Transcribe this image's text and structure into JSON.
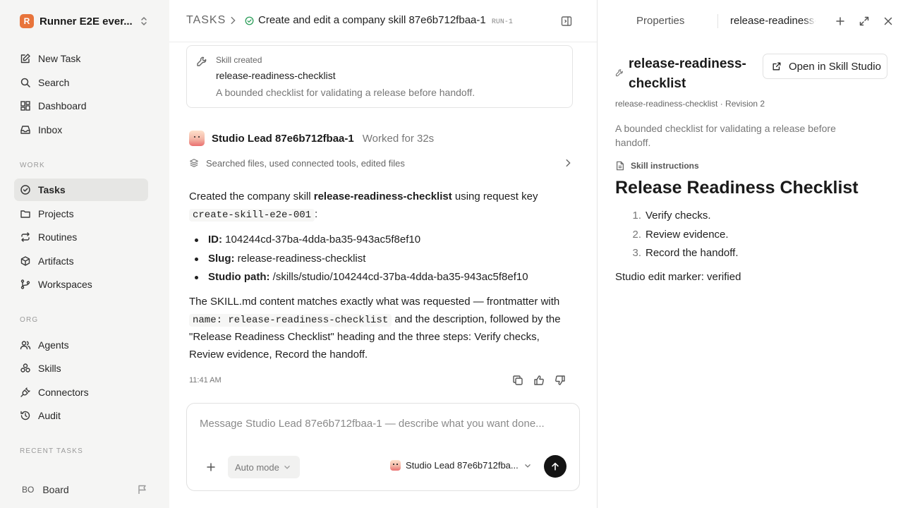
{
  "workspace": {
    "logo": "R",
    "name": "Runner E2E ever..."
  },
  "nav_main": [
    {
      "label": "New Task",
      "icon": "edit-icon"
    },
    {
      "label": "Search",
      "icon": "search-icon"
    },
    {
      "label": "Dashboard",
      "icon": "dashboard-icon"
    },
    {
      "label": "Inbox",
      "icon": "inbox-icon"
    }
  ],
  "section_work": "WORK",
  "nav_work": [
    {
      "label": "Tasks",
      "icon": "check-circle-icon",
      "active": true
    },
    {
      "label": "Projects",
      "icon": "folder-icon"
    },
    {
      "label": "Routines",
      "icon": "repeat-icon"
    },
    {
      "label": "Artifacts",
      "icon": "box-icon"
    },
    {
      "label": "Workspaces",
      "icon": "branch-icon"
    }
  ],
  "section_org": "ORG",
  "nav_org": [
    {
      "label": "Agents",
      "icon": "users-icon"
    },
    {
      "label": "Skills",
      "icon": "skills-icon"
    },
    {
      "label": "Connectors",
      "icon": "plug-icon"
    },
    {
      "label": "Audit",
      "icon": "history-icon"
    }
  ],
  "section_recent": "RECENT TASKS",
  "board": {
    "initials": "BO",
    "label": "Board"
  },
  "header": {
    "crumb": "TASKS",
    "title": "Create and edit a company skill 87e6b712fbaa-1",
    "run": "RUN-1"
  },
  "skill_card": {
    "label": "Skill created",
    "name": "release-readiness-checklist",
    "description": "A bounded checklist for validating a release before handoff."
  },
  "agent": {
    "name": "Studio Lead 87e6b712fbaa-1",
    "worked": "Worked for 32s"
  },
  "activity": "Searched files, used connected tools, edited files",
  "message": {
    "p1_a": "Created the company skill ",
    "p1_bold": "release-readiness-checklist",
    "p1_b": " using request key",
    "p1_code": "create-skill-e2e-001",
    "p1_c": ":",
    "bullets": [
      {
        "k": "ID:",
        "v": " 104244cd-37ba-4dda-ba35-943ac5f8ef10"
      },
      {
        "k": "Slug:",
        "v": " release-readiness-checklist"
      },
      {
        "k": "Studio path:",
        "v": " /skills/studio/104244cd-37ba-4dda-ba35-943ac5f8ef10"
      }
    ],
    "p2_a": "The SKILL.md content matches exactly what was requested — frontmatter with",
    "p2_code": "name: release-readiness-checklist",
    "p2_b": " and the description, followed by the \"Release Readiness Checklist\" heading and the three steps: Verify checks, Review evidence, Record the handoff.",
    "time": "11:41 AM"
  },
  "composer": {
    "placeholder": "Message Studio Lead 87e6b712fbaa-1 — describe what you want done...",
    "mode": "Auto mode",
    "agent": "Studio Lead 87e6b712fba..."
  },
  "rpanel": {
    "tab_properties": "Properties",
    "tab_active": "release-readiness-checklist",
    "title": "release-readiness-checklist",
    "open_button": "Open in Skill Studio",
    "meta": "release-readiness-checklist · Revision 2",
    "description": "A bounded checklist for validating a release before handoff.",
    "instructions_label": "Skill instructions",
    "heading": "Release Readiness Checklist",
    "steps": [
      "Verify checks.",
      "Review evidence.",
      "Record the handoff."
    ],
    "marker": "Studio edit marker: verified"
  }
}
